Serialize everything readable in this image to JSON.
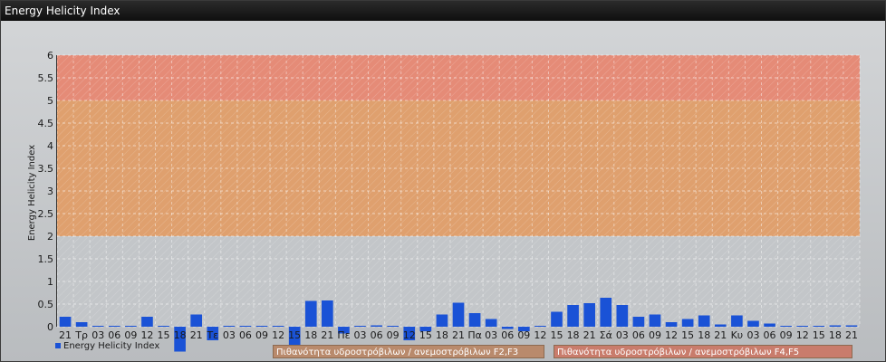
{
  "window_title": "Energy Helicity Index",
  "colors": {
    "bar": "#1a52d6",
    "band_red": "#e58b77",
    "band_orange": "#dfa06e",
    "band_gray": "#c3c6c9"
  },
  "band_labels": {
    "mid": "Πιθανότητα υδροστρόβιλων / ανεμοστρόβιλων F2,F3",
    "high": "Πιθανότητα υδροστρόβιλων / ανεμοστρόβιλων F4,F5"
  },
  "chart_data": {
    "type": "bar",
    "title": "",
    "ylabel": "Energy Helicity Index",
    "xlabel": "",
    "ylim": [
      0,
      6
    ],
    "yticks": [
      "0",
      "0.5",
      "1",
      "1.5",
      "2",
      "2.5",
      "3",
      "3.5",
      "4",
      "4.5",
      "5",
      "5.5",
      "6"
    ],
    "bands": [
      {
        "from": 0,
        "to": 2,
        "color": "#c3c6c9"
      },
      {
        "from": 2,
        "to": 5,
        "color": "#dfa06e"
      },
      {
        "from": 5,
        "to": 6,
        "color": "#e58b77"
      }
    ],
    "legend": "Energy Helicity Index",
    "grid": true,
    "categories": [
      "21",
      "Τρ",
      "03",
      "06",
      "09",
      "12",
      "15",
      "18",
      "21",
      "Τε",
      "03",
      "06",
      "09",
      "12",
      "15",
      "18",
      "21",
      "Πε",
      "03",
      "06",
      "09",
      "12",
      "15",
      "18",
      "21",
      "Πα",
      "03",
      "06",
      "09",
      "12",
      "15",
      "18",
      "21",
      "Σά",
      "03",
      "06",
      "09",
      "12",
      "15",
      "18",
      "21",
      "Κυ",
      "03",
      "06",
      "09",
      "12",
      "15",
      "18",
      "21"
    ],
    "series": [
      {
        "name": "Energy Helicity Index",
        "values": [
          0.22,
          0.1,
          0.02,
          0.02,
          0.02,
          0.22,
          0.02,
          -0.55,
          0.27,
          -0.3,
          0.02,
          0.02,
          0.02,
          0.02,
          -0.5,
          0.57,
          0.58,
          -0.15,
          0.02,
          0.03,
          0.02,
          -0.3,
          -0.1,
          0.27,
          0.53,
          0.3,
          0.17,
          -0.05,
          -0.1,
          0.02,
          0.33,
          0.48,
          0.52,
          0.64,
          0.48,
          0.22,
          0.27,
          0.1,
          0.17,
          0.25,
          0.05,
          0.25,
          0.13,
          0.07,
          0.02,
          0.02,
          0.02,
          0.03,
          0.03
        ]
      }
    ]
  }
}
